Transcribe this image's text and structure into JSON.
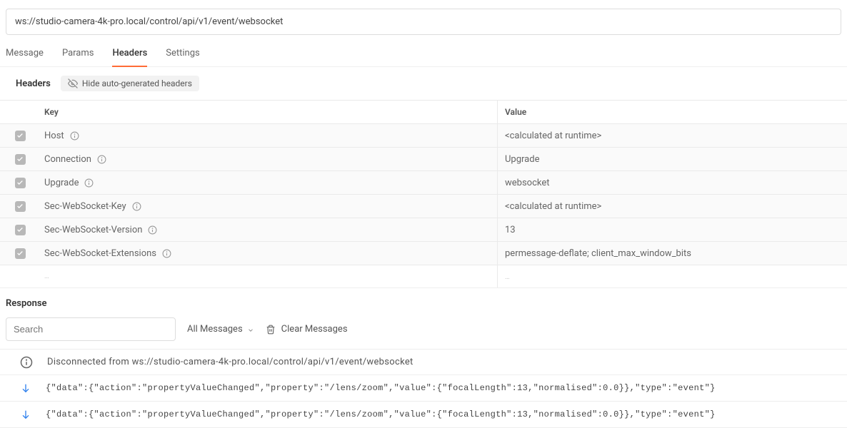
{
  "url": "ws://studio-camera-4k-pro.local/control/api/v1/event/websocket",
  "tabs": {
    "message": "Message",
    "params": "Params",
    "headers": "Headers",
    "settings": "Settings"
  },
  "section": {
    "title": "Headers",
    "hide_auto": "Hide auto-generated headers"
  },
  "table": {
    "key_label": "Key",
    "value_label": "Value",
    "rows": [
      {
        "key": "Host",
        "value": "<calculated at runtime>"
      },
      {
        "key": "Connection",
        "value": "Upgrade"
      },
      {
        "key": "Upgrade",
        "value": "websocket"
      },
      {
        "key": "Sec-WebSocket-Key",
        "value": "<calculated at runtime>"
      },
      {
        "key": "Sec-WebSocket-Version",
        "value": "13"
      },
      {
        "key": "Sec-WebSocket-Extensions",
        "value": "permessage-deflate; client_max_window_bits"
      }
    ]
  },
  "response": {
    "title": "Response",
    "search_placeholder": "Search",
    "filter": "All Messages",
    "clear": "Clear Messages",
    "messages": [
      {
        "type": "info",
        "text": "Disconnected from ws://studio-camera-4k-pro.local/control/api/v1/event/websocket"
      },
      {
        "type": "incoming",
        "text": "{\"data\":{\"action\":\"propertyValueChanged\",\"property\":\"/lens/zoom\",\"value\":{\"focalLength\":13,\"normalised\":0.0}},\"type\":\"event\"}"
      },
      {
        "type": "incoming",
        "text": "{\"data\":{\"action\":\"propertyValueChanged\",\"property\":\"/lens/zoom\",\"value\":{\"focalLength\":13,\"normalised\":0.0}},\"type\":\"event\"}"
      }
    ]
  }
}
